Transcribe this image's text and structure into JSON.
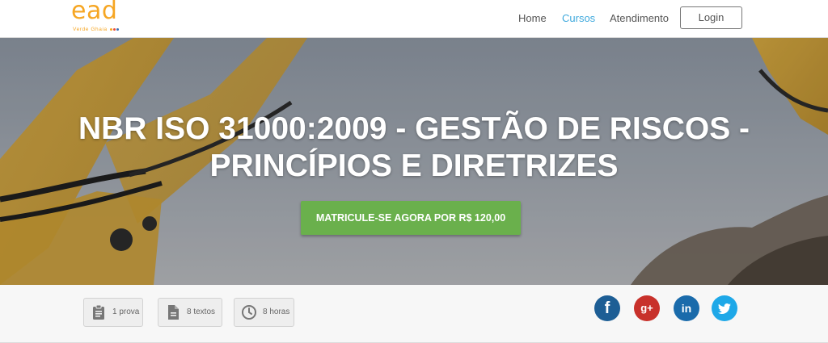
{
  "brand": {
    "logo_text": "ead",
    "logo_subtext": "Verde Ghaia",
    "colors": {
      "logo": "#f6a623",
      "accent": "#3fa9dd",
      "cta": "#6ab04c"
    }
  },
  "nav": {
    "items": [
      {
        "label": "Home",
        "active": false
      },
      {
        "label": "Cursos",
        "active": true
      },
      {
        "label": "Atendimento",
        "active": false
      }
    ],
    "login_label": "Login"
  },
  "hero": {
    "title": "NBR ISO 31000:2009 - GESTÃO DE RISCOS - PRINCÍPIOS E DIRETRIZES",
    "cta_label": "MATRICULE-SE AGORA POR R$ 120,00"
  },
  "course_info": [
    {
      "icon": "clipboard-icon",
      "label": "1 prova"
    },
    {
      "icon": "document-icon",
      "label": "8 textos"
    },
    {
      "icon": "clock-icon",
      "label": "8 horas"
    }
  ],
  "social": [
    {
      "icon": "facebook-icon",
      "glyph": "f",
      "color": "#1d5e95"
    },
    {
      "icon": "google-plus-icon",
      "glyph": "g+",
      "color": "#c8312b"
    },
    {
      "icon": "linkedin-icon",
      "glyph": "in",
      "color": "#1a6bab"
    },
    {
      "icon": "twitter-icon",
      "glyph": "",
      "color": "#1ea8e8"
    }
  ]
}
